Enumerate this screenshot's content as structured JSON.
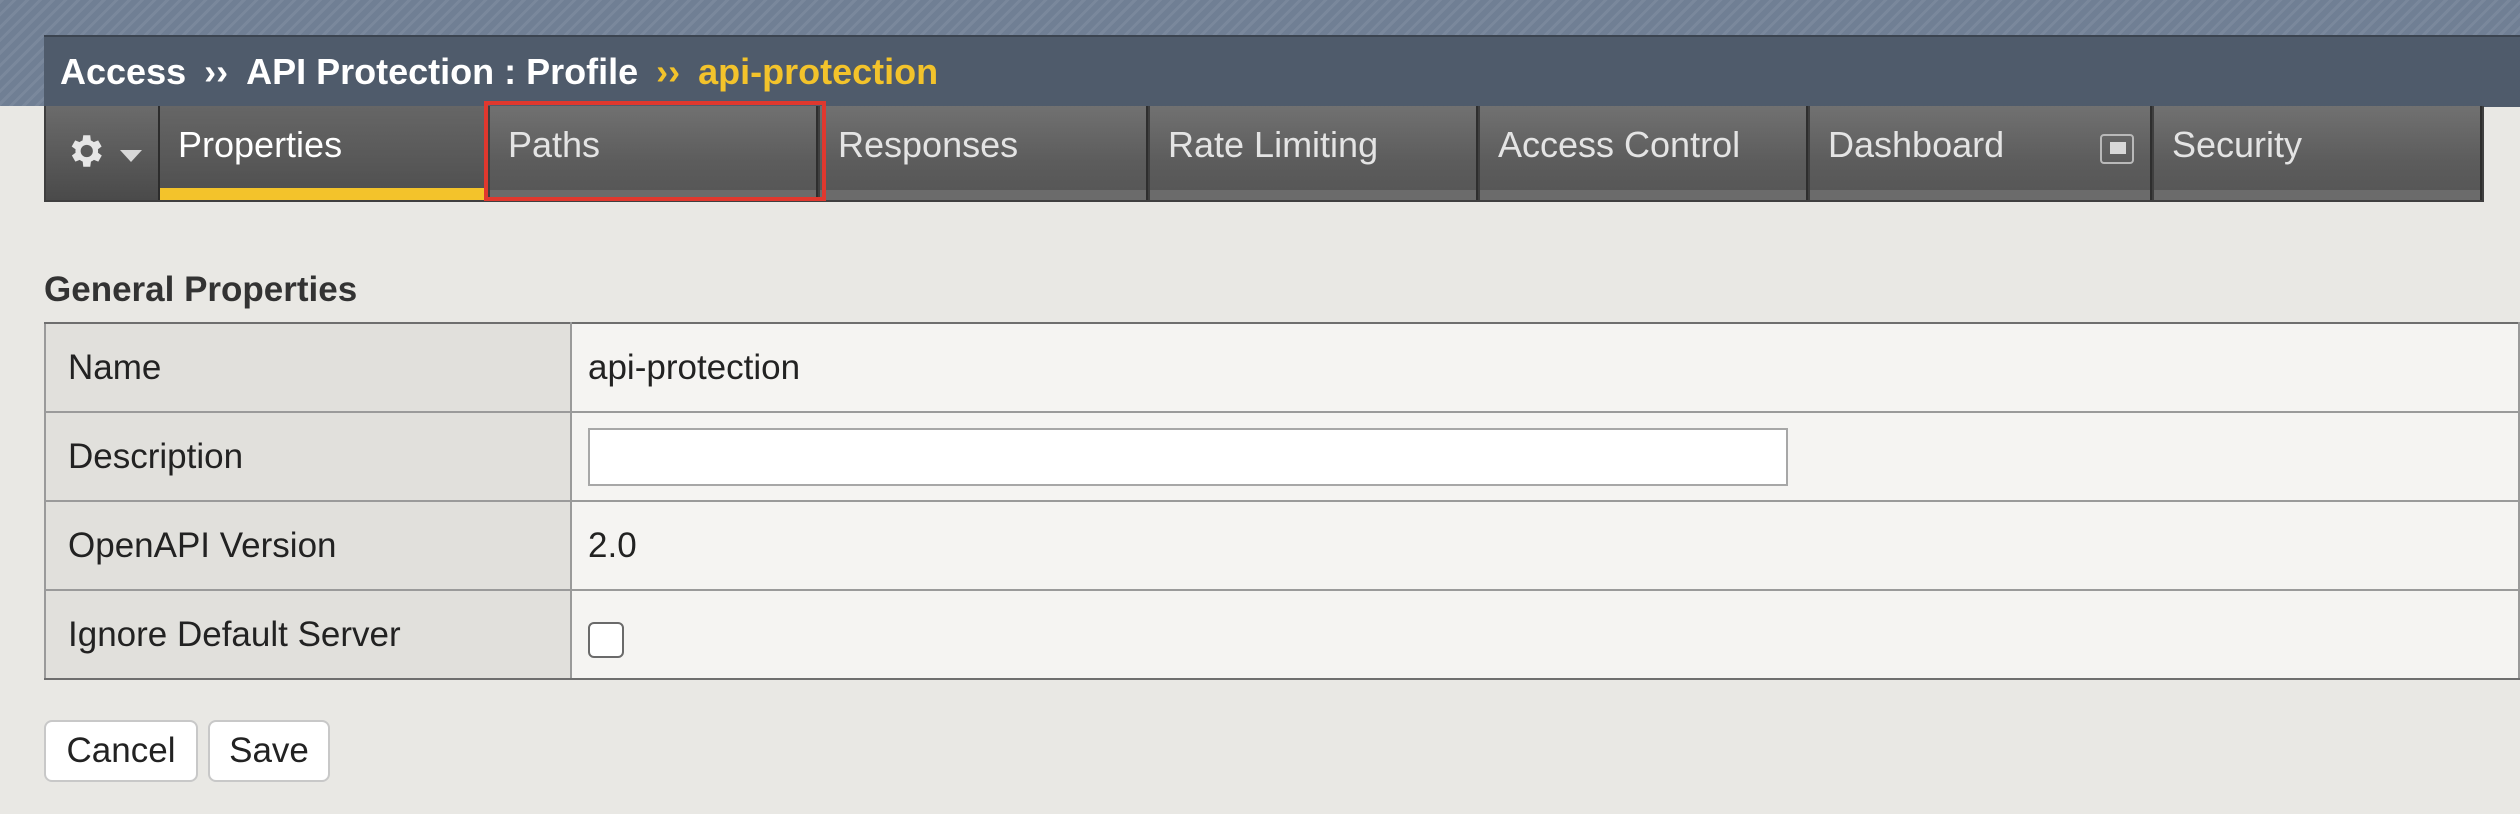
{
  "breadcrumb": {
    "items": [
      "Access",
      "API Protection : Profile"
    ],
    "separator": "››",
    "current": "api-protection"
  },
  "tabs": [
    {
      "label": "Properties",
      "active": true
    },
    {
      "label": "Paths",
      "active": false,
      "highlighted": true
    },
    {
      "label": "Responses",
      "active": false
    },
    {
      "label": "Rate Limiting",
      "active": false
    },
    {
      "label": "Access Control",
      "active": false
    },
    {
      "label": "Dashboard",
      "active": false,
      "icon": "window-icon"
    },
    {
      "label": "Security",
      "active": false
    }
  ],
  "settings_menu_icon": "gear-icon",
  "section": {
    "title": "General Properties",
    "rows": [
      {
        "label": "Name",
        "value": "api-protection"
      },
      {
        "label": "Description",
        "value": ""
      },
      {
        "label": "OpenAPI Version",
        "value": "2.0"
      },
      {
        "label": "Ignore Default Server",
        "checked": false
      }
    ]
  },
  "actions": {
    "cancel": "Cancel",
    "save": "Save"
  },
  "colors": {
    "accent": "#f3c32b",
    "highlight": "#e0382e"
  }
}
